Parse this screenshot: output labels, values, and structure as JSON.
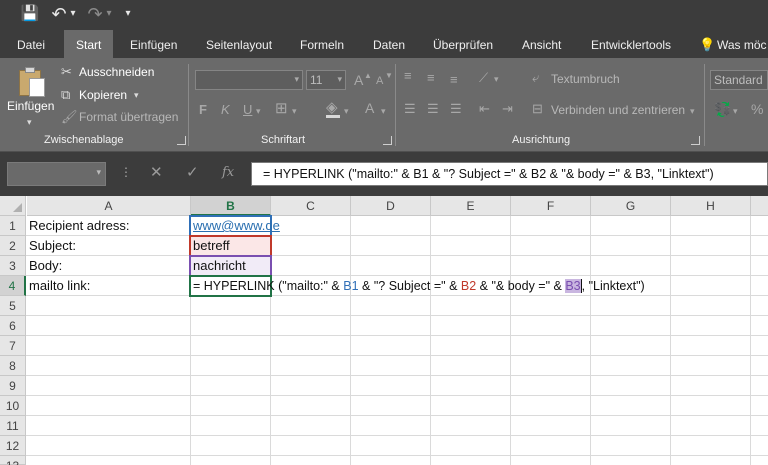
{
  "quick_access": {
    "save": "💾",
    "undo": "↶",
    "undo_dd": "▾",
    "redo": "↷",
    "redo_dd": "▾",
    "customize": "▾"
  },
  "tabs": [
    "Datei",
    "Start",
    "Einfügen",
    "Seitenlayout",
    "Formeln",
    "Daten",
    "Überprüfen",
    "Ansicht",
    "Entwicklertools"
  ],
  "tell_me": "Was möc",
  "ribbon": {
    "clipboard": {
      "paste": "Einfügen",
      "cut": "Ausschneiden",
      "copy": "Kopieren",
      "format_painter": "Format übertragen",
      "group_label": "Zwischenablage"
    },
    "font": {
      "font_size": "11",
      "bold": "F",
      "italic": "K",
      "underline": "U",
      "grow": "A",
      "shrink": "A",
      "color_a": "A",
      "group_label": "Schriftart"
    },
    "alignment": {
      "wrap_text": "Textumbruch",
      "merge_center": "Verbinden und zentrieren",
      "group_label": "Ausrichtung"
    },
    "number": {
      "format": "Standard",
      "percent": "%"
    }
  },
  "formula_bar": {
    "cancel": "✕",
    "enter": "✓",
    "fx": "fx",
    "formula": "= HYPERLINK (\"mailto:\" & B1 & \"? Subject =\" & B2 & \"& body =\" & B3, \"Linktext\")"
  },
  "columns": [
    "A",
    "B",
    "C",
    "D",
    "E",
    "F",
    "G",
    "H"
  ],
  "rows": [
    "1",
    "2",
    "3",
    "4",
    "5",
    "6",
    "7",
    "8",
    "9",
    "10",
    "11",
    "12",
    "13"
  ],
  "cells": {
    "A1": "Recipient adress:",
    "A2": "Subject:",
    "A3": "Body:",
    "A4": "mailto link:",
    "B1": "www@www.de",
    "B2": "betreff",
    "B3": "nachricht"
  },
  "b4_parts": {
    "p1": "= HYPERLINK (\"mailto:\" & ",
    "r1": "B1",
    "p2": " & \"? Subject =\" & ",
    "r2": "B2",
    "p3": " & \"& body =\" & ",
    "r3": "B3",
    "p4": ", \"Linktext\")"
  },
  "colors": {
    "ribbon_bg": "#6a6a6a",
    "titlebar_bg": "#3c3c3c",
    "selection_green": "#217346",
    "ref_blue": "#2f6fb7",
    "ref_red": "#c0392b",
    "ref_purple": "#7a4fb0"
  }
}
